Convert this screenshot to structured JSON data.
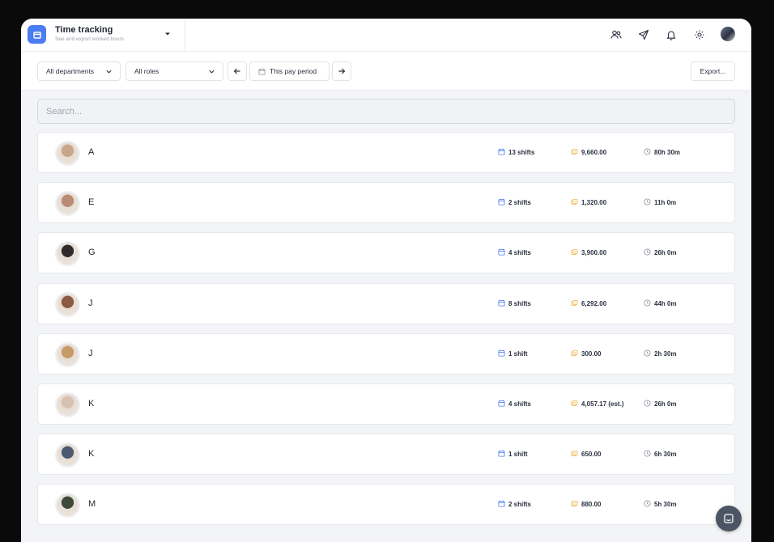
{
  "header": {
    "title": "Time tracking",
    "subtitle": "See and export worked hours."
  },
  "toolbar": {
    "departments": "All departments",
    "roles": "All roles",
    "period": "This pay period",
    "export": "Export..."
  },
  "search": {
    "placeholder": "Search..."
  },
  "employees": [
    {
      "initial": "A",
      "shifts": "13 shifts",
      "pay": "9,660.00",
      "hours": "80h 30m",
      "avatar": "#c9a58a"
    },
    {
      "initial": "E",
      "shifts": "2 shifts",
      "pay": "1,320.00",
      "hours": "11h 0m",
      "avatar": "#b98a74"
    },
    {
      "initial": "G",
      "shifts": "4 shifts",
      "pay": "3,900.00",
      "hours": "26h 0m",
      "avatar": "#2f2b2a"
    },
    {
      "initial": "J",
      "shifts": "8 shifts",
      "pay": "6,292.00",
      "hours": "44h 0m",
      "avatar": "#8a5a42"
    },
    {
      "initial": "J",
      "shifts": "1 shift",
      "pay": "300.00",
      "hours": "2h 30m",
      "avatar": "#c79a6a"
    },
    {
      "initial": "K",
      "shifts": "4 shifts",
      "pay": "4,057.17 (est.)",
      "hours": "26h 0m",
      "avatar": "#d8c1b0"
    },
    {
      "initial": "K",
      "shifts": "1 shift",
      "pay": "650.00",
      "hours": "6h 30m",
      "avatar": "#4b5a70"
    },
    {
      "initial": "M",
      "shifts": "2 shifts",
      "pay": "880.00",
      "hours": "5h 30m",
      "avatar": "#3d4a3a"
    }
  ],
  "colors": {
    "accent": "#4a7cf2",
    "shifts_icon": "#4a7cf2",
    "pay_icon": "#f0b64a",
    "time_icon": "#8a909c"
  },
  "icons": {
    "header": [
      "team-icon",
      "send-icon",
      "bell-icon",
      "gear-icon"
    ],
    "row": [
      "calendar-icon",
      "coins-icon",
      "clock-icon"
    ]
  }
}
